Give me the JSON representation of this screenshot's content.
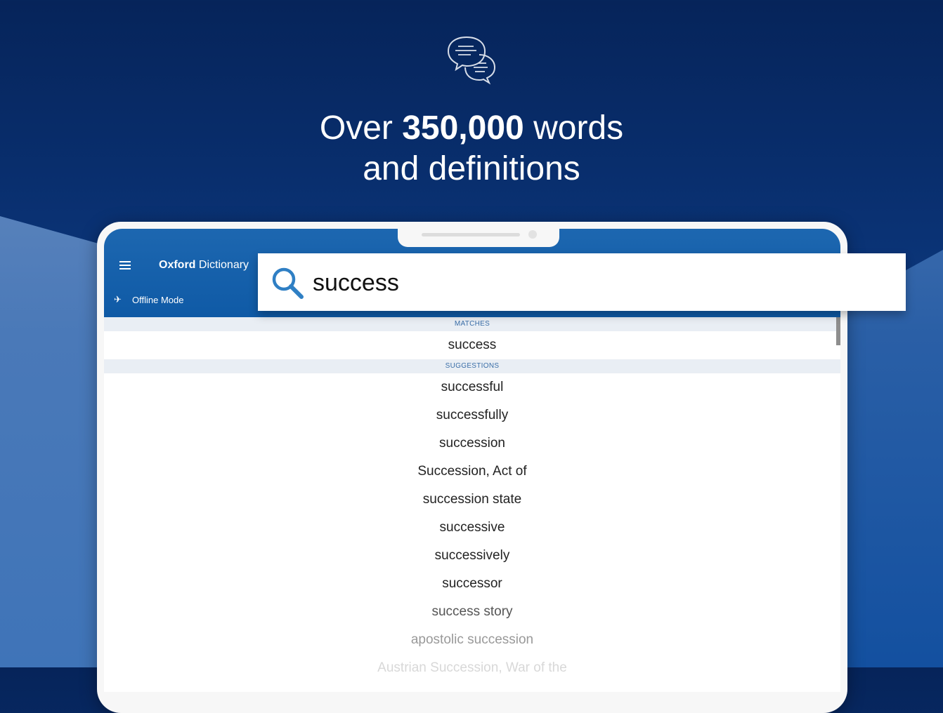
{
  "promo": {
    "headline_prefix": "Over",
    "headline_bold": "350,000",
    "headline_suffix": "words",
    "headline_line2": "and definitions",
    "icon": "chat-bubbles-icon"
  },
  "app": {
    "title_bold": "Oxford",
    "title_regular": "Dictionary",
    "menu_icon": "hamburger-menu-icon",
    "offline_icon": "airplane-icon",
    "offline_label": "Offline Mode",
    "accent_color": "#0f5aa6"
  },
  "search": {
    "icon": "search-icon",
    "value": "success"
  },
  "results": {
    "matches_header": "MATCHES",
    "matches": [
      "success"
    ],
    "suggestions_header": "SUGGESTIONS",
    "suggestions": [
      "successful",
      "successfully",
      "succession",
      "Succession, Act of",
      "succession state",
      "successive",
      "successively",
      "successor",
      "success story",
      "apostolic succession",
      "Austrian Succession, War of the"
    ]
  }
}
